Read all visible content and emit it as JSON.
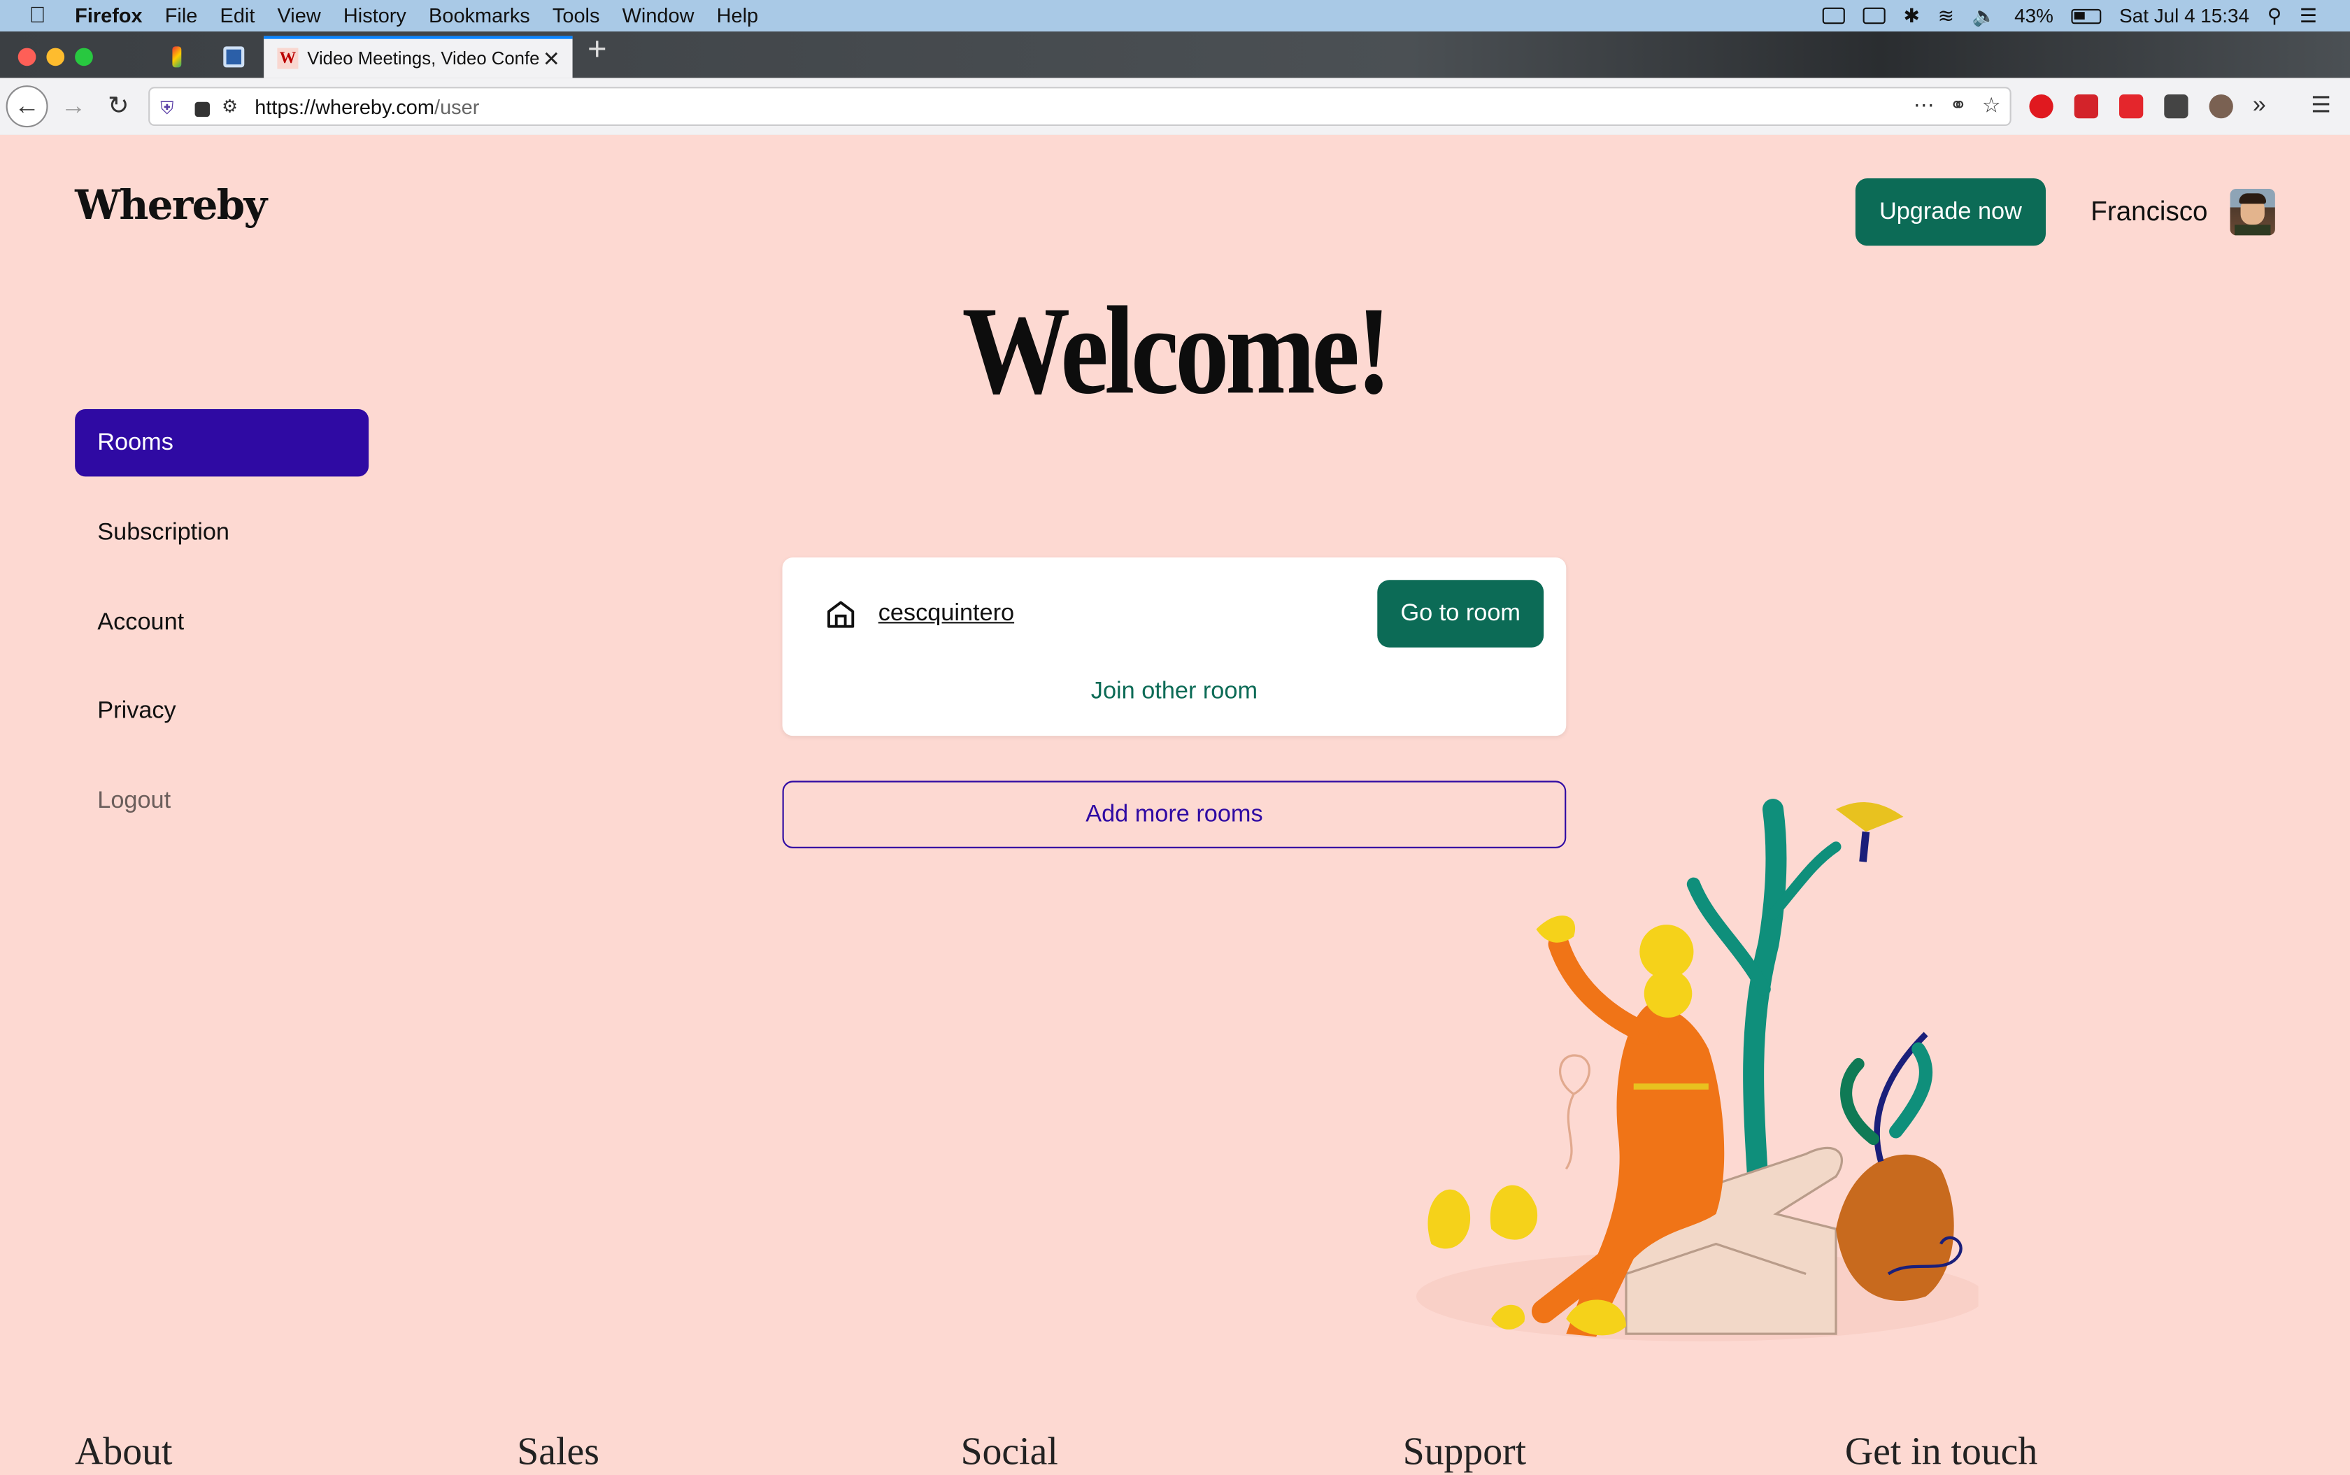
{
  "menubar": {
    "app": "Firefox",
    "items": [
      "File",
      "Edit",
      "View",
      "History",
      "Bookmarks",
      "Tools",
      "Window",
      "Help"
    ],
    "battery": "43%",
    "clock": "Sat Jul 4  15:34"
  },
  "browser": {
    "active_tab_title": "Video Meetings, Video Conferenc",
    "url_host": "https://whereby.com",
    "url_path": "/user",
    "new_tab_glyph": "+"
  },
  "header": {
    "logo": "Whereby",
    "upgrade_label": "Upgrade now",
    "username": "Francisco"
  },
  "main": {
    "title": "Welcome!",
    "room_name": "cescquintero",
    "go_to_room_label": "Go to room",
    "join_other_label": "Join other room",
    "add_rooms_label": "Add more rooms"
  },
  "sidebar": {
    "items": [
      {
        "label": "Rooms"
      },
      {
        "label": "Subscription"
      },
      {
        "label": "Account"
      },
      {
        "label": "Privacy"
      },
      {
        "label": "Logout"
      }
    ]
  },
  "footer": {
    "headings": [
      "About",
      "Sales",
      "Social",
      "Support",
      "Get in touch"
    ]
  },
  "colors": {
    "page_bg": "#fdd9d2",
    "primary_green": "#0c6b56",
    "accent_purple": "#2f0aa3"
  }
}
